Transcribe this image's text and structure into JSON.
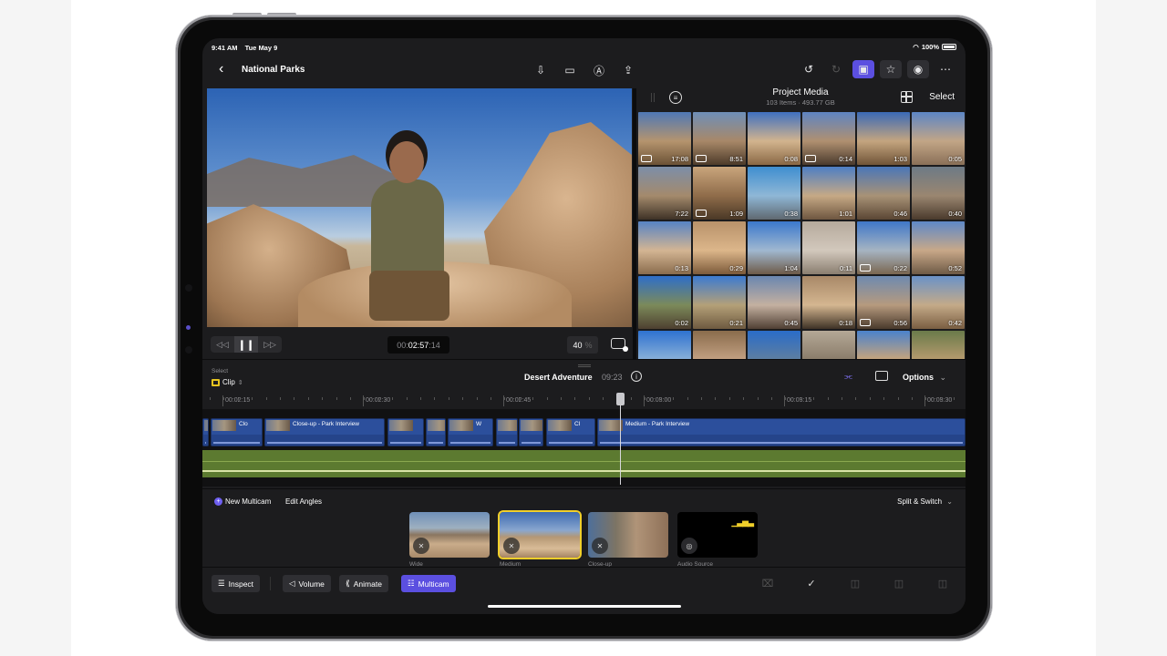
{
  "status_bar": {
    "time": "9:41 AM",
    "date": "Tue May 9",
    "battery": "100%"
  },
  "nav": {
    "back_icon": "chevron-left-icon",
    "title": "National Parks",
    "center_icons": [
      "import-icon",
      "camera-icon",
      "pencil-markup-icon",
      "share-icon"
    ],
    "right_icons": [
      "undo-icon",
      "redo-icon",
      "photos-browser-icon",
      "titles-effects-icon",
      "voiceover-icon",
      "more-icon"
    ]
  },
  "viewer": {
    "timecode_prefix": "00:",
    "timecode_main": "02:57",
    "timecode_suffix": ":14",
    "zoom_value": "40",
    "zoom_unit": "%"
  },
  "browser": {
    "title": "Project Media",
    "subtitle": "103 Items  ·  493.77 GB",
    "select_label": "Select",
    "thumbnails": [
      {
        "duration": "17:08",
        "badge": "multicam"
      },
      {
        "duration": "8:51",
        "badge": "multicam"
      },
      {
        "duration": "0:08",
        "badge": ""
      },
      {
        "duration": "0:14",
        "badge": "camera"
      },
      {
        "duration": "1:03",
        "badge": ""
      },
      {
        "duration": "0:05",
        "badge": ""
      },
      {
        "duration": "7:22",
        "badge": ""
      },
      {
        "duration": "1:09",
        "badge": "camera"
      },
      {
        "duration": "0:38",
        "badge": ""
      },
      {
        "duration": "1:01",
        "badge": ""
      },
      {
        "duration": "0:46",
        "badge": ""
      },
      {
        "duration": "0:40",
        "badge": ""
      },
      {
        "duration": "0:13",
        "badge": ""
      },
      {
        "duration": "0:29",
        "badge": ""
      },
      {
        "duration": "1:04",
        "badge": ""
      },
      {
        "duration": "0:11",
        "badge": ""
      },
      {
        "duration": "0:22",
        "badge": "camera"
      },
      {
        "duration": "0:52",
        "badge": ""
      },
      {
        "duration": "0:02",
        "badge": ""
      },
      {
        "duration": "0:21",
        "badge": ""
      },
      {
        "duration": "0:45",
        "badge": ""
      },
      {
        "duration": "0:18",
        "badge": ""
      },
      {
        "duration": "0:56",
        "badge": "camera"
      },
      {
        "duration": "0:42",
        "badge": ""
      },
      {
        "duration": "",
        "badge": ""
      },
      {
        "duration": "",
        "badge": ""
      },
      {
        "duration": "",
        "badge": ""
      },
      {
        "duration": "",
        "badge": ""
      },
      {
        "duration": "",
        "badge": ""
      },
      {
        "duration": "",
        "badge": ""
      }
    ]
  },
  "timeline": {
    "select_label": "Select",
    "clip_mode": "Clip",
    "project_name": "Desert Adventure",
    "project_duration": "09:23",
    "options_label": "Options",
    "ruler_labels": [
      "00:02:15",
      "00:02:30",
      "00:02:45",
      "00:03:00",
      "00:03:15",
      "00:03:30"
    ],
    "clips": [
      {
        "label": ""
      },
      {
        "label": "Clo"
      },
      {
        "label": "Close-up - Park Interview"
      },
      {
        "label": ""
      },
      {
        "label": ""
      },
      {
        "label": "W"
      },
      {
        "label": ""
      },
      {
        "label": ""
      },
      {
        "label": "Cl"
      },
      {
        "label": "Medium - Park Interview"
      }
    ]
  },
  "multicam": {
    "new_label": "New Multicam",
    "edit_label": "Edit Angles",
    "mode_label": "Split & Switch",
    "angles": [
      {
        "label": "Wide",
        "selected": false
      },
      {
        "label": "Medium",
        "selected": true
      },
      {
        "label": "Close-up",
        "selected": false
      },
      {
        "label": "Audio Source",
        "selected": false
      }
    ]
  },
  "toolbar": {
    "inspect": "Inspect",
    "volume": "Volume",
    "animate": "Animate",
    "multicam": "Multicam"
  },
  "colors": {
    "accent": "#5b4fe0",
    "selection": "#f0cf2a",
    "video_clip": "#2c4f9c",
    "audio_clip": "#5c7a30"
  }
}
